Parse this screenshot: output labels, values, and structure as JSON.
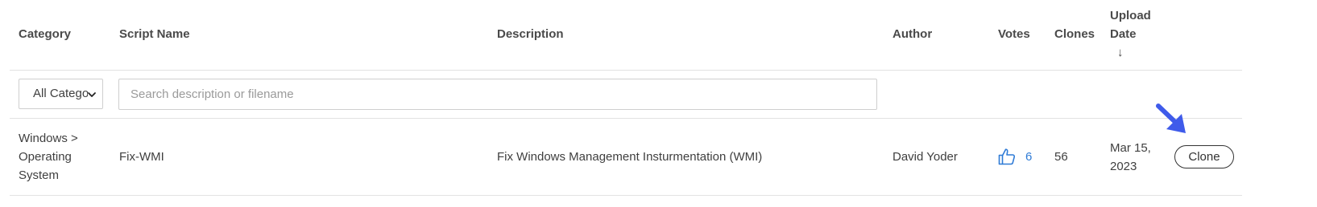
{
  "columns": {
    "category": "Category",
    "script_name": "Script Name",
    "description": "Description",
    "author": "Author",
    "votes": "Votes",
    "clones": "Clones",
    "upload_date_line1": "Upload",
    "upload_date_line2": "Date",
    "sort_indicator": "↓"
  },
  "filters": {
    "category_selected": "All Categories",
    "search_placeholder": "Search description or filename",
    "search_value": ""
  },
  "rows": [
    {
      "category_line1": "Windows >",
      "category_line2": "Operating",
      "category_line3": "System",
      "script_name": "Fix-WMI",
      "description": "Fix Windows Management Insturmentation (WMI)",
      "author": "David Yoder",
      "votes": "6",
      "clones": "56",
      "date_line1": "Mar 15,",
      "date_line2": "2023",
      "action_label": "Clone"
    }
  ],
  "icons": {
    "vote": "thumbs-up-icon",
    "select": "chevron-down-icon",
    "pointer": "arrow-pointer-icon"
  },
  "colors": {
    "link_blue": "#2f7bd6",
    "pointer_arrow": "#3f5bea",
    "border": "#cfcfcf"
  }
}
